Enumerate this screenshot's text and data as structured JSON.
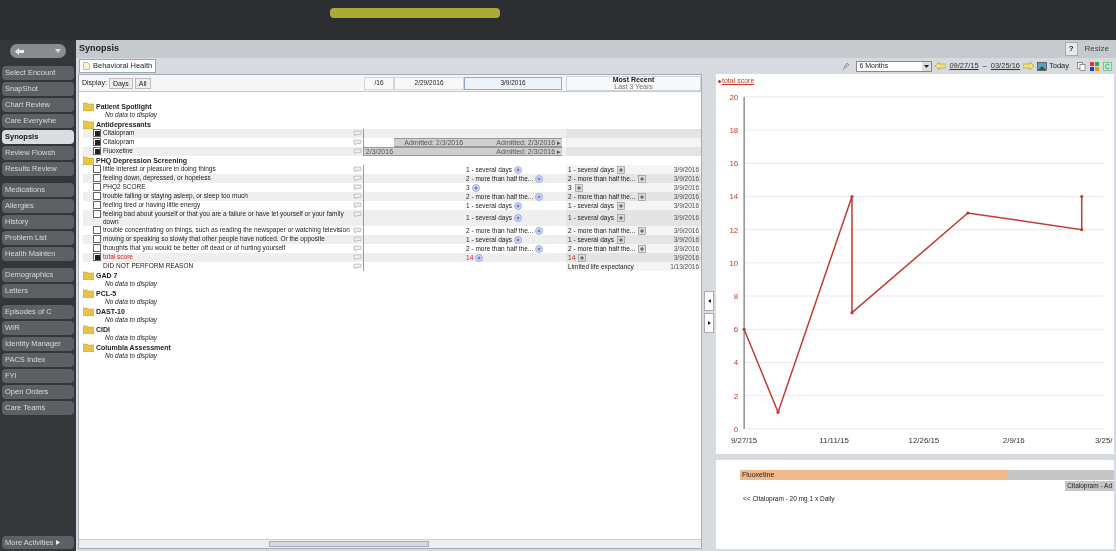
{
  "sidebar": {
    "groups": [
      [
        {
          "label": "Select Encount",
          "selected": false
        },
        {
          "label": "SnapShot",
          "selected": false
        },
        {
          "label": "Chart Review",
          "selected": false
        },
        {
          "label": "Care Everywhe",
          "selected": false
        },
        {
          "label": "Synopsis",
          "selected": true
        },
        {
          "label": "Review Flowsh",
          "selected": false
        },
        {
          "label": "Results Review",
          "selected": false
        }
      ],
      [
        {
          "label": "Medications",
          "selected": false
        },
        {
          "label": "Allergies",
          "selected": false
        },
        {
          "label": "History",
          "selected": false
        },
        {
          "label": "Problem List",
          "selected": false
        },
        {
          "label": "Health Mainten",
          "selected": false
        }
      ],
      [
        {
          "label": "Demographics",
          "selected": false
        },
        {
          "label": "Letters",
          "selected": false
        }
      ],
      [
        {
          "label": "Episodes of C",
          "selected": false
        },
        {
          "label": "WIR",
          "selected": false
        },
        {
          "label": "Identity Manager",
          "selected": false
        },
        {
          "label": "PACS Index",
          "selected": false
        },
        {
          "label": "FYI",
          "selected": false
        },
        {
          "label": "Open Orders",
          "selected": false
        },
        {
          "label": "Care Teams",
          "selected": false
        }
      ]
    ],
    "more": "More Activities"
  },
  "title": "Synopsis",
  "help": "?",
  "resize": "Resize",
  "tabs": [
    {
      "label": "Behavioral Health",
      "selected": true
    }
  ],
  "display": {
    "label": "Display:",
    "buttons": [
      {
        "label": "Days",
        "selected": false
      },
      {
        "label": "All",
        "selected": false
      }
    ]
  },
  "date_columns": [
    {
      "label": "/16",
      "selected": false
    },
    {
      "label": "2/29/2016",
      "selected": false
    },
    {
      "label": "3/9/2016",
      "selected": true
    }
  ],
  "most_recent": {
    "label": "Most Recent",
    "sublabel": "Last 3 Years"
  },
  "sections": [
    {
      "title": "Patient Spotlight",
      "empty_text": "No data to display"
    },
    {
      "title": "Antidepressants",
      "rows": [
        {
          "kind": "med",
          "label": "Citalopram",
          "checked": true,
          "cells": [
            {
              "bar": false
            },
            {
              "bar": false
            },
            {
              "bar": false
            }
          ]
        },
        {
          "kind": "med",
          "label": "Citalopram",
          "checked": true,
          "cells": [
            {
              "bar": false
            },
            {
              "bar": true,
              "text": "Admitted: 2/3/2016"
            },
            {
              "bar": true,
              "text": "Admitted: 2/3/2016 ▸"
            }
          ]
        },
        {
          "kind": "med",
          "label": "Fluoxetine",
          "checked": true,
          "cells": [
            {
              "bar": true,
              "text": "2/3/2016"
            },
            {
              "bar": true
            },
            {
              "bar": true,
              "text": "Admitted: 2/3/2016 ▸"
            }
          ]
        }
      ]
    },
    {
      "title": "PHQ Depression Screening",
      "rows": [
        {
          "kind": "question",
          "label": "little interest or pleasure in doing things",
          "checked": false,
          "alert": false,
          "current": "1 - several days",
          "recent": {
            "value": "1 - several days",
            "date": "3/9/2016"
          }
        },
        {
          "kind": "question",
          "label": "feeling down, depressed, or hopeless",
          "checked": false,
          "alert": false,
          "current": "2 - more than half the...",
          "recent": {
            "value": "2 - more than half the...",
            "date": "3/9/2016"
          }
        },
        {
          "kind": "question",
          "label": "PHQ2 SCORE",
          "checked": false,
          "alert": false,
          "current": "3",
          "recent": {
            "value": "3",
            "date": "3/9/2016"
          }
        },
        {
          "kind": "question",
          "label": "trouble falling or staying asleep, or sleep too much",
          "checked": false,
          "alert": false,
          "current": "2 - more than half the...",
          "recent": {
            "value": "2 - more than half the...",
            "date": "3/9/2016"
          }
        },
        {
          "kind": "question",
          "label": "feeling tired or having little energy",
          "checked": false,
          "alert": false,
          "current": "1 - several days",
          "recent": {
            "value": "1 - several days",
            "date": "3/9/2016"
          }
        },
        {
          "kind": "question",
          "label": "feeling bad about yourself or that you are a failure or have let yourself or your family down",
          "checked": false,
          "alert": false,
          "current": "1 - several days",
          "recent": {
            "value": "1 - several days",
            "date": "3/9/2016"
          }
        },
        {
          "kind": "question",
          "label": "trouble concentrating on things, such as reading the newspaper or watching television",
          "checked": false,
          "alert": false,
          "current": "2 - more than half the...",
          "recent": {
            "value": "2 - more than half the...",
            "date": "3/9/2016"
          }
        },
        {
          "kind": "question",
          "label": "moving or speaking so slowly that other people have noticed. Or the opposite",
          "checked": false,
          "alert": false,
          "current": "1 - several days",
          "recent": {
            "value": "1 - several days",
            "date": "3/9/2016"
          }
        },
        {
          "kind": "question",
          "label": "thoughts that you would be better off dead or of hurting yourself",
          "checked": false,
          "alert": false,
          "current": "2 - more than half the...",
          "recent": {
            "value": "2 - more than half the...",
            "date": "3/9/2016"
          }
        },
        {
          "kind": "question",
          "label": "total score",
          "checked": true,
          "alert": true,
          "current": "14",
          "recent": {
            "value": "14",
            "date": "3/9/2016"
          }
        },
        {
          "kind": "reason",
          "label": "DID NOT PERFORM REASON",
          "alert": false,
          "recent": {
            "value": "Limited life expectancy",
            "date": "1/13/2016"
          }
        }
      ]
    },
    {
      "title": "GAD 7",
      "empty_text": "No data to display"
    },
    {
      "title": "PCL-5",
      "empty_text": "No data to display"
    },
    {
      "title": "DAST-10",
      "empty_text": "No data to display"
    },
    {
      "title": "CIDI",
      "empty_text": "No data to display"
    },
    {
      "title": "Columbia Assessment",
      "empty_text": "No data to display"
    }
  ],
  "chart_toolbar": {
    "range": "6 Months",
    "start": "09/27/15",
    "dash": "–",
    "end": "03/25/16",
    "today": "Today"
  },
  "chart": {
    "chart_data": {
      "type": "line",
      "x": [
        "2015-09-27",
        "2015-10-14",
        "2015-11-20",
        "2015-11-20",
        "2016-01-17",
        "2016-03-14",
        "2016-03-14"
      ],
      "series": [
        {
          "name": "total score",
          "color": "#c0392b",
          "values": [
            6,
            1,
            14,
            7,
            13,
            12,
            14
          ]
        }
      ],
      "grid": true,
      "xlim": [
        "2015-09-27",
        "2016-03-25"
      ],
      "ylim": [
        0,
        20
      ],
      "xticks": [
        {
          "value": "2015-09-27",
          "label": "9/27/15"
        },
        {
          "value": "2015-11-11",
          "label": "11/11/15"
        },
        {
          "value": "2015-12-26",
          "label": "12/26/15"
        },
        {
          "value": "2016-02-09",
          "label": "2/9/16"
        },
        {
          "value": "2016-03-25",
          "label": "3/25/"
        }
      ],
      "yticks": [
        0,
        2,
        4,
        6,
        8,
        10,
        12,
        14,
        16,
        18,
        20
      ]
    }
  },
  "med_timeline": {
    "bars": [
      {
        "label": "Fluoxetine",
        "color": "#f2b98a"
      }
    ],
    "label": "Citalopram - Ad",
    "note": "<< Citalopram - 20 mg 1 x Daily"
  }
}
